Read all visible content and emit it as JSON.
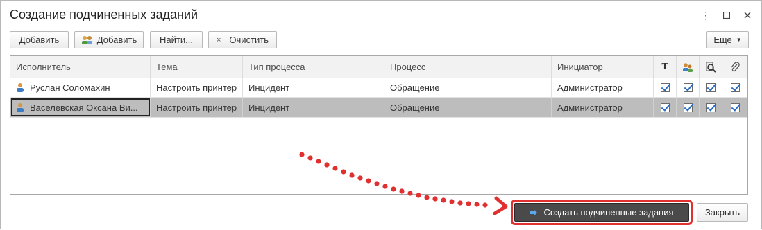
{
  "window": {
    "title": "Создание подчиненных заданий"
  },
  "toolbar": {
    "add_label": "Добавить",
    "add_group_label": "Добавить",
    "find_label": "Найти...",
    "clear_label": "Очистить",
    "more_label": "Еще"
  },
  "table": {
    "columns": [
      "Исполнитель",
      "Тема",
      "Тип процесса",
      "Процесс",
      "Инициатор"
    ],
    "icon_columns": [
      "text-icon",
      "users-icon",
      "search-doc-icon",
      "attachment-icon"
    ],
    "rows": [
      {
        "executor": "Руслан Соломахин",
        "topic": "Настроить принтер",
        "process_type": "Инцидент",
        "process": "Обращение",
        "initiator": "Администратор",
        "checks": [
          true,
          true,
          true,
          true
        ]
      },
      {
        "executor": "Васелевская Оксана Ви...",
        "topic": "Настроить принтер",
        "process_type": "Инцидент",
        "process": "Обращение",
        "initiator": "Администратор",
        "checks": [
          true,
          true,
          true,
          true
        ]
      }
    ]
  },
  "footer": {
    "create_label": "Создать подчиненные задания",
    "close_label": "Закрыть"
  },
  "colors": {
    "highlight": "#e03030",
    "primary_bg": "#4a4a4a",
    "selection": "#bdbdbd",
    "check": "#2a6ec4"
  }
}
